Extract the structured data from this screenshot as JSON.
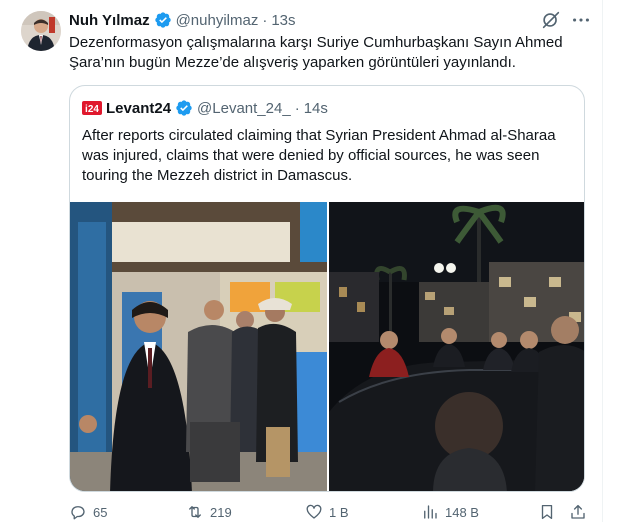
{
  "author": {
    "name": "Nuh Yılmaz",
    "handle": "@nuhyilmaz",
    "separator": "·",
    "time": "13s"
  },
  "tweet_text": "Dezenformasyon çalışmalarına karşı Suriye Cumhurbaşkanı Sayın Ahmed Şara’nın bugün Mezze’de alışveriş yaparken görüntüleri yayınlandı.",
  "quote": {
    "logo_text": "i24",
    "name": "Levant24",
    "handle": "@Levant_24_",
    "separator": "·",
    "time": "14s",
    "text": "After reports circulated claiming that Syrian President Ahmad al-Sharaa was injured, claims that were denied by official sources, he was seen touring the Mezzeh district in Damascus.",
    "images": [
      "shop-interior-photo",
      "night-street-photo"
    ]
  },
  "actions": {
    "reply_count": "65",
    "retweet_count": "219",
    "like_count": "1 B",
    "view_count": "148 B"
  },
  "icons": [
    "verified-badge-icon",
    "grok-icon",
    "more-icon",
    "reply-icon",
    "retweet-icon",
    "like-icon",
    "views-icon",
    "bookmark-icon",
    "share-icon"
  ],
  "colors": {
    "verified": "#1d9bf0",
    "secondary_text": "#536471",
    "border": "#cfd9de",
    "quote_logo_red": "#e0182d"
  }
}
